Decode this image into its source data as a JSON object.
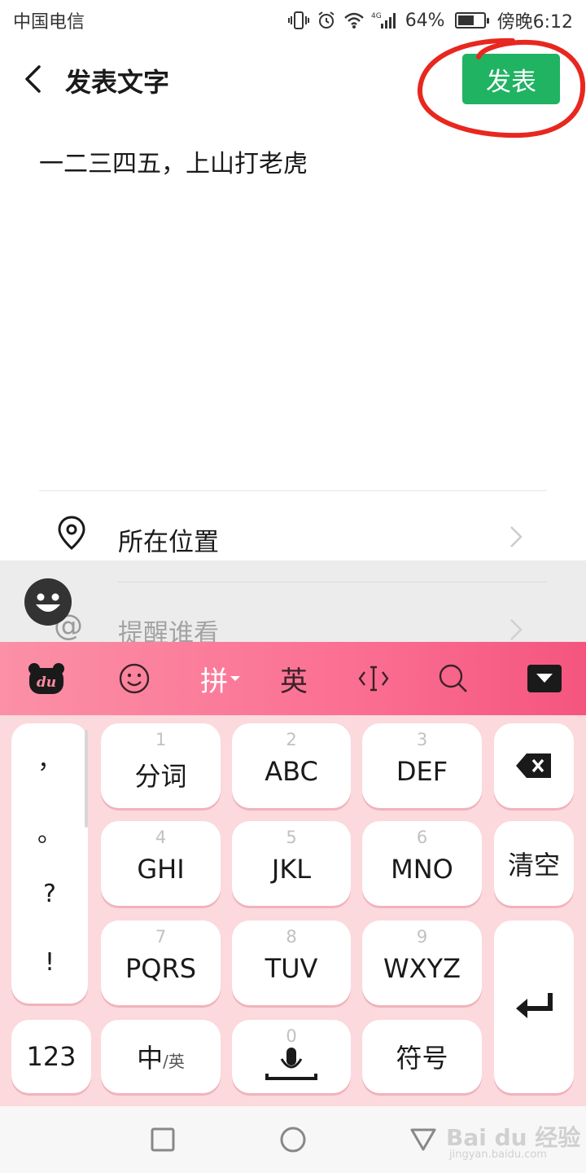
{
  "status_bar": {
    "carrier": "中国电信",
    "network": "4G",
    "battery": "64%",
    "battery_level": 0.64,
    "time": "傍晚6:12"
  },
  "header": {
    "back_icon": "chevron-left-icon",
    "title": "发表文字",
    "publish_label": "发表",
    "publish_color": "#1fb362",
    "annotation_color": "#e8271f"
  },
  "post": {
    "text": "一二三四五，上山打老虎"
  },
  "options": {
    "location_label": "所在位置",
    "remind_label": "提醒谁看"
  },
  "keyboard": {
    "accent_color": "#fb6f92",
    "toolbar": {
      "logo_text": "du",
      "pinyin_label": "拼",
      "english_label": "英"
    },
    "punctuation": [
      "，",
      "。",
      "?",
      "!"
    ],
    "keys": {
      "k1": {
        "num": "1",
        "label": "分词"
      },
      "k2": {
        "num": "2",
        "label": "ABC"
      },
      "k3": {
        "num": "3",
        "label": "DEF"
      },
      "k4": {
        "num": "4",
        "label": "GHI"
      },
      "k5": {
        "num": "5",
        "label": "JKL"
      },
      "k6": {
        "num": "6",
        "label": "MNO"
      },
      "k7": {
        "num": "7",
        "label": "PQRS"
      },
      "k8": {
        "num": "8",
        "label": "TUV"
      },
      "k9": {
        "num": "9",
        "label": "WXYZ"
      },
      "k0": {
        "num": "0"
      },
      "clear": "清空",
      "num_mode": "123",
      "lang_main": "中",
      "lang_alt": "/英",
      "symbols": "符号"
    }
  },
  "watermark": {
    "brand": "Bai du 经验",
    "url": "jingyan.baidu.com"
  }
}
